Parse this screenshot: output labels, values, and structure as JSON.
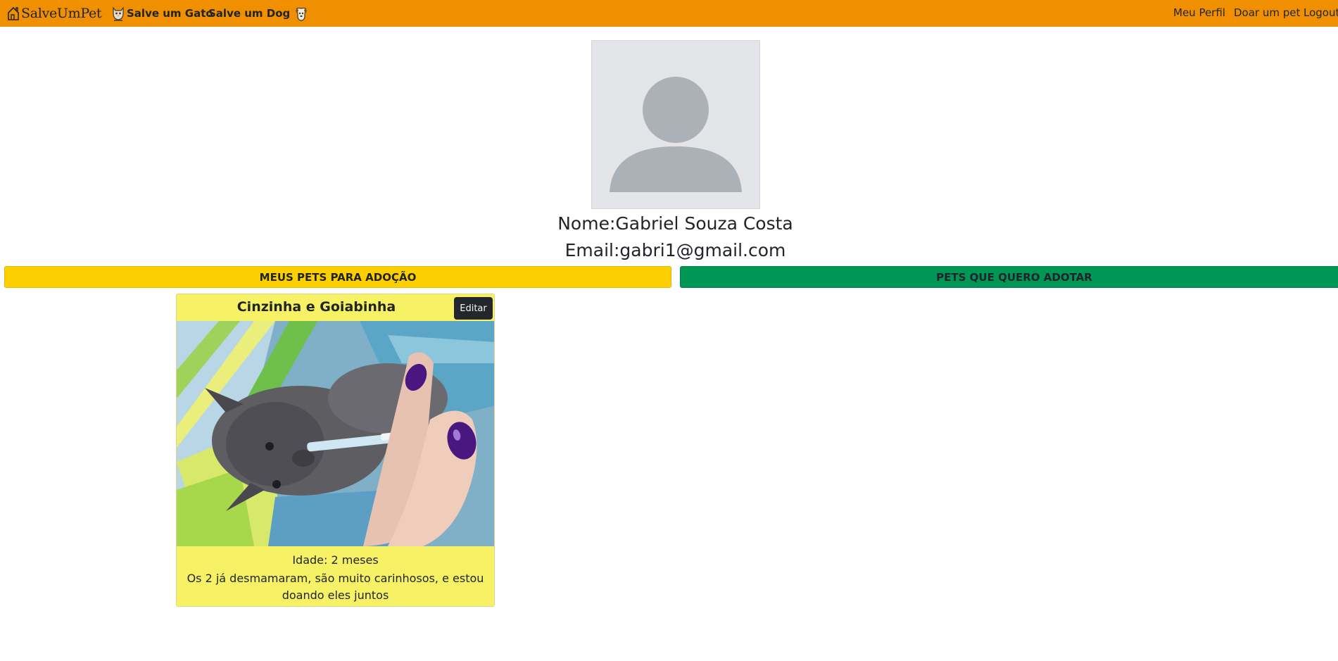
{
  "navbar": {
    "brand": "SalveUmPet",
    "brand_icon": "house-icon",
    "links": [
      {
        "label": "Salve um Gato",
        "icon": "cat-icon"
      },
      {
        "label": "Salve um Dog",
        "icon": "dog-icon"
      }
    ],
    "right_links": [
      "Meu Perfil",
      "Doar um pet",
      "Logout"
    ]
  },
  "profile": {
    "avatar_icon": "user-placeholder-icon",
    "name_line": "Nome:Gabriel Souza Costa",
    "email_line": "Email:gabri1@gmail.com"
  },
  "tabs": {
    "my_pets": "MEUS PETS PARA ADOÇÃO",
    "want_adopt": "PETS QUE QUERO ADOTAR"
  },
  "pets": [
    {
      "name": "Cinzinha e Goiabinha",
      "edit_label": "Editar",
      "age": "Idade: 2 meses",
      "description": "Os 2 já desmamaram, são muito carinhosos, e estou doando eles juntos",
      "photo": "kitten-bottle-feeding-photo"
    }
  ],
  "colors": {
    "navbar": "#f09000",
    "tab_yellow": "#fcd000",
    "tab_green": "#009656",
    "card": "#f7f265",
    "edit_button": "#23262a"
  }
}
